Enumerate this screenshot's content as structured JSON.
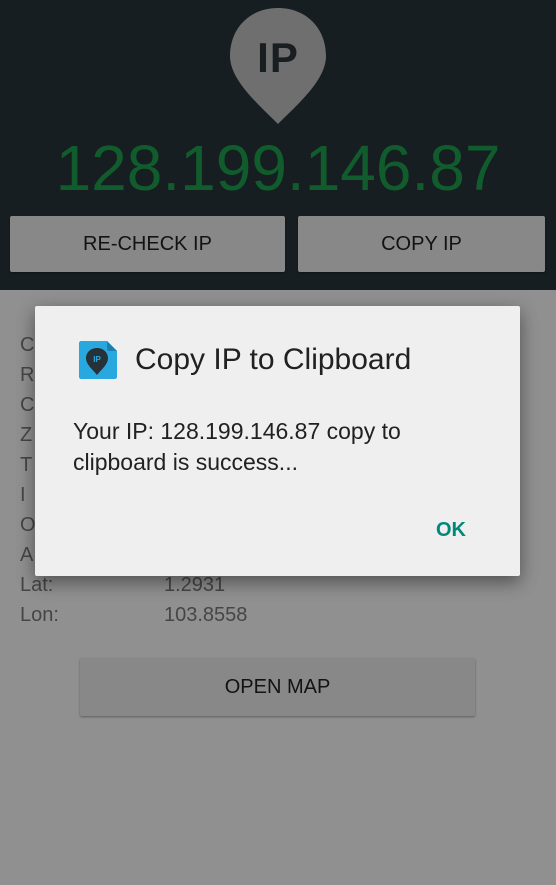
{
  "header": {
    "pin_label": "IP",
    "ip_address": "128.199.146.87",
    "recheck_label": "RE-CHECK IP",
    "copy_label": "COPY IP"
  },
  "info": {
    "rows": [
      {
        "key": "C",
        "value": ""
      },
      {
        "key": "R",
        "value": ""
      },
      {
        "key": "C",
        "value": ""
      },
      {
        "key": "Z",
        "value": ""
      },
      {
        "key": "T",
        "value": ""
      },
      {
        "key": "I",
        "value": ""
      },
      {
        "key": "O",
        "value": ""
      },
      {
        "key": "A",
        "value": ""
      },
      {
        "key": "Lat:",
        "value": "1.2931"
      },
      {
        "key": "Lon:",
        "value": "103.8558"
      }
    ]
  },
  "open_map_label": "OPEN MAP",
  "dialog": {
    "title": "Copy IP to Clipboard",
    "icon_label": "IP",
    "message": "Your IP: 128.199.146.87 copy to clipboard is success...",
    "ok_label": "OK"
  },
  "colors": {
    "header_bg": "#263238",
    "ip_text": "#1d9a4a",
    "accent": "#00897b",
    "dialog_icon": "#29a8e0"
  }
}
